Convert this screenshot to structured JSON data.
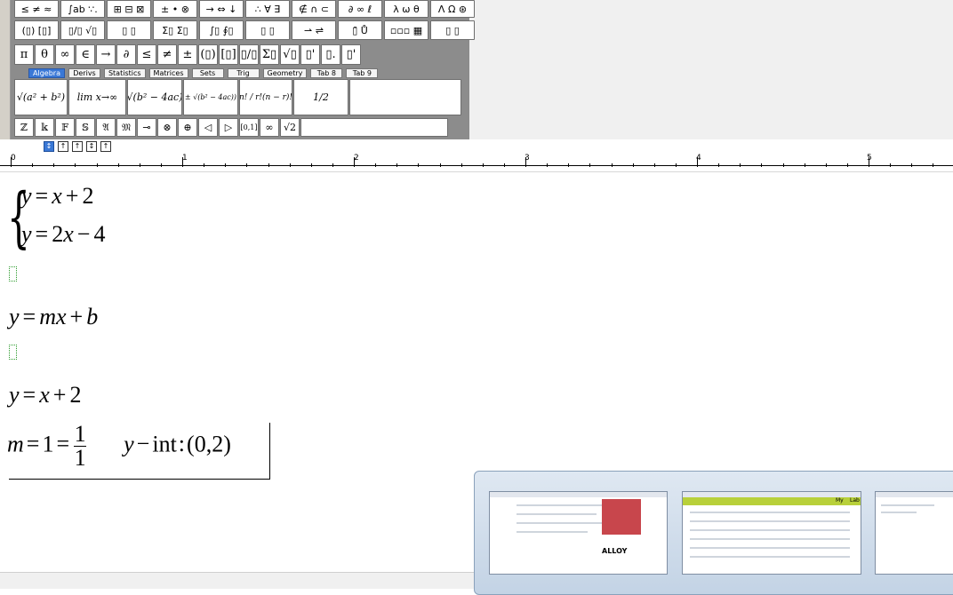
{
  "toolbar": {
    "row1": [
      "≤ ≠ ≈",
      "∫ab ∵.",
      "⊞ ⊟ ⊠",
      "± • ⊗",
      "→ ⇔ ↓",
      "∴ ∀ ∃",
      "∉ ∩ ⊂",
      "∂ ∞ ℓ",
      "λ ω θ",
      "Λ Ω ⊛"
    ],
    "row2": [
      "(▯) [▯]",
      "▯/▯ √▯",
      "▯ ▯",
      "Σ▯ Σ▯",
      "∫▯ ∮▯",
      "▯ ▯",
      "⇀ ⇌",
      "▯̄ Ů",
      "▫▫▫ ▦",
      "▯ ▯"
    ],
    "row3": [
      "π",
      "θ",
      "∞",
      "∈",
      "→",
      "∂",
      "≤",
      "≠",
      "±",
      "(▯)",
      "[▯]",
      "▯/▯",
      "Σ▯",
      "√▯",
      "▯'",
      "▯.",
      "▯'"
    ],
    "tabs": [
      "Algebra",
      "Derivs",
      "Statistics",
      "Matrices",
      "Sets",
      "Trig",
      "Geometry",
      "Tab 8",
      "Tab 9"
    ],
    "active_tab": "Algebra",
    "row4": [
      {
        "label": "√(a² + b²)"
      },
      {
        "label": "lim x→∞"
      },
      {
        "label": "√(b² − 4ac)"
      },
      {
        "label": "(−b ± √(b² − 4ac)) / 2a"
      },
      {
        "label": "n! / r!(n − r)!"
      },
      {
        "label": "1/2"
      }
    ],
    "row5": [
      "ℤ",
      "𝕜",
      "𝔽",
      "𝕊",
      "𝔄",
      "𝔐",
      "⊸",
      "⊗",
      "⊕",
      "◁",
      "▷",
      "[0,1]",
      "∞",
      "√2"
    ],
    "small_buttons": [
      "↕",
      "↑",
      "↑",
      "↕",
      "↑"
    ]
  },
  "ruler": {
    "labels": [
      "0",
      "1",
      "2",
      "3",
      "4",
      "5"
    ]
  },
  "editor": {
    "system_line1": [
      "y",
      "=",
      "x",
      "+",
      "2"
    ],
    "system_line2": [
      "y",
      "=",
      "2",
      "x",
      "−",
      "4"
    ],
    "slope_intercept": [
      "y",
      "=",
      "m",
      "x",
      "+",
      "b"
    ],
    "line3": [
      "y",
      "=",
      "x",
      "+",
      "2"
    ],
    "slope": {
      "var": "m",
      "eq1": "=",
      "value": "1",
      "eq2": "=",
      "frac_num": "1",
      "frac_den": "1"
    },
    "intercept": {
      "var": "y",
      "minus": "−",
      "word": "int",
      "colon": ":",
      "point": "(0,2)"
    }
  },
  "taskbar_thumbnails": {
    "thumb1_text": "ALLOY",
    "thumb2_tabs": [
      "My",
      "Lab"
    ]
  }
}
